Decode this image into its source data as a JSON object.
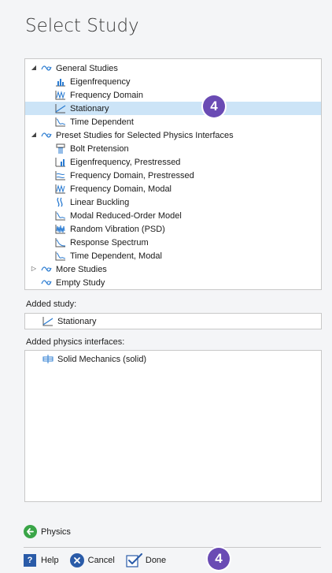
{
  "title": "Select Study",
  "tree": [
    {
      "label": "General Studies",
      "level": 0,
      "expand": "expanded",
      "icon": "study-group-icon"
    },
    {
      "label": "Eigenfrequency",
      "level": 1,
      "icon": "eigenfrequency-icon"
    },
    {
      "label": "Frequency Domain",
      "level": 1,
      "icon": "frequency-domain-icon"
    },
    {
      "label": "Stationary",
      "level": 1,
      "icon": "stationary-icon",
      "selected": true
    },
    {
      "label": "Time Dependent",
      "level": 1,
      "icon": "time-dependent-icon"
    },
    {
      "label": "Preset Studies for Selected Physics Interfaces",
      "level": 0,
      "expand": "expanded",
      "icon": "study-group-icon"
    },
    {
      "label": "Bolt Pretension",
      "level": 1,
      "icon": "bolt-pretension-icon"
    },
    {
      "label": "Eigenfrequency, Prestressed",
      "level": 1,
      "icon": "eigenfrequency-prestressed-icon"
    },
    {
      "label": "Frequency Domain, Prestressed",
      "level": 1,
      "icon": "frequency-domain-prestressed-icon"
    },
    {
      "label": "Frequency Domain, Modal",
      "level": 1,
      "icon": "frequency-domain-icon"
    },
    {
      "label": "Linear Buckling",
      "level": 1,
      "icon": "linear-buckling-icon"
    },
    {
      "label": "Modal Reduced-Order Model",
      "level": 1,
      "icon": "time-dependent-icon"
    },
    {
      "label": "Random Vibration (PSD)",
      "level": 1,
      "icon": "random-vibration-icon"
    },
    {
      "label": "Response Spectrum",
      "level": 1,
      "icon": "response-spectrum-icon"
    },
    {
      "label": "Time Dependent, Modal",
      "level": 1,
      "icon": "time-dependent-icon"
    },
    {
      "label": "More Studies",
      "level": 0,
      "expand": "collapsed",
      "icon": "study-group-icon"
    },
    {
      "label": "Empty Study",
      "level": 0,
      "expand": "none",
      "icon": "study-group-icon"
    }
  ],
  "badge_text": "4",
  "added_study": {
    "label": "Added study:",
    "value": "Stationary",
    "icon": "stationary-icon"
  },
  "added_physics": {
    "label": "Added physics interfaces:",
    "items": [
      "Solid Mechanics (solid)"
    ],
    "icon": "solid-mechanics-icon"
  },
  "nav": {
    "physics": "Physics",
    "icon": "back-arrow-icon"
  },
  "bottom": {
    "help": "Help",
    "cancel": "Cancel",
    "done": "Done"
  },
  "colors": {
    "accent_badge": "#6a4bb4",
    "selected_row": "#cce4f7",
    "help_blue": "#2a5ba8",
    "green": "#3aa548"
  }
}
